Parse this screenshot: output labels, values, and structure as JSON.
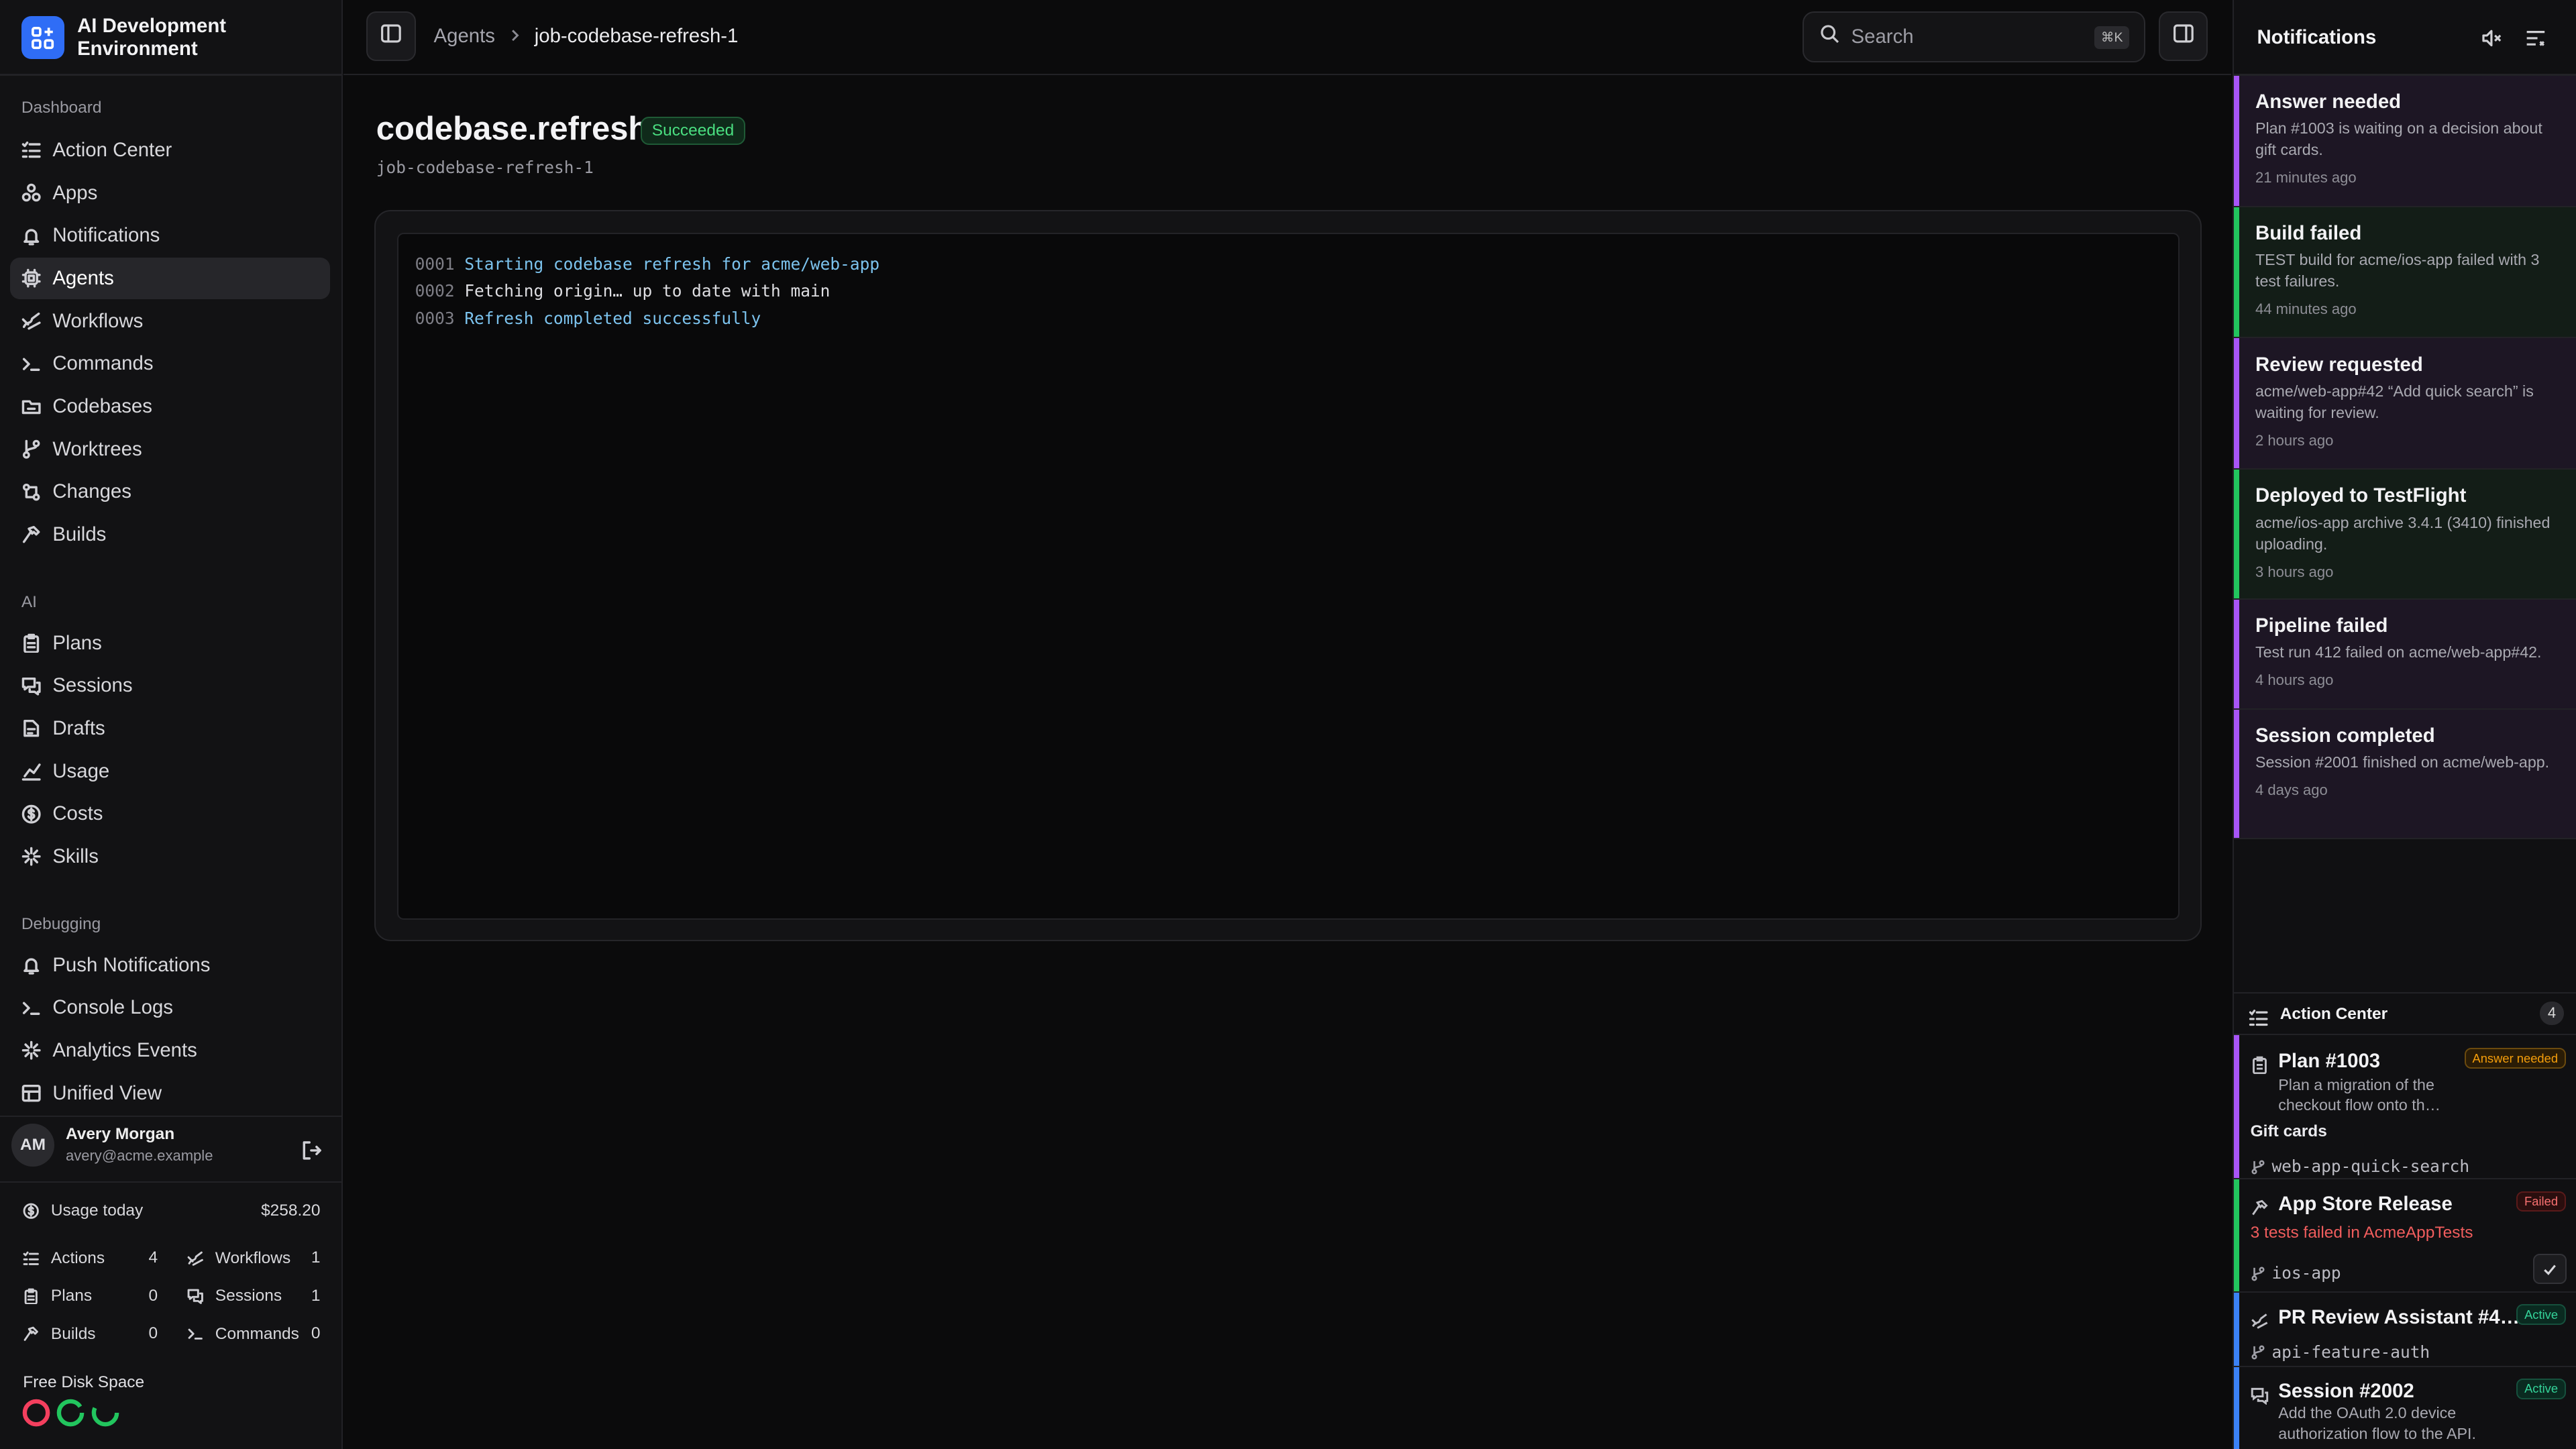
{
  "app": {
    "name": "AI Development Environment"
  },
  "sidebar": {
    "sections": [
      {
        "title": "Dashboard",
        "items": [
          {
            "label": "Action Center",
            "icon": "checklist-icon"
          },
          {
            "label": "Apps",
            "icon": "apps-icon"
          },
          {
            "label": "Notifications",
            "icon": "bell-icon"
          },
          {
            "label": "Agents",
            "icon": "agent-icon",
            "active": true
          },
          {
            "label": "Workflows",
            "icon": "workflow-icon"
          },
          {
            "label": "Commands",
            "icon": "terminal-icon"
          },
          {
            "label": "Codebases",
            "icon": "folder-icon"
          },
          {
            "label": "Worktrees",
            "icon": "branch-icon"
          },
          {
            "label": "Changes",
            "icon": "diff-icon"
          },
          {
            "label": "Builds",
            "icon": "hammer-icon"
          }
        ]
      },
      {
        "title": "AI",
        "items": [
          {
            "label": "Plans",
            "icon": "clipboard-icon"
          },
          {
            "label": "Sessions",
            "icon": "chat-icon"
          },
          {
            "label": "Drafts",
            "icon": "draft-icon"
          },
          {
            "label": "Usage",
            "icon": "chart-icon"
          },
          {
            "label": "Costs",
            "icon": "dollar-icon"
          },
          {
            "label": "Skills",
            "icon": "sparkle-icon"
          }
        ]
      },
      {
        "title": "Debugging",
        "items": [
          {
            "label": "Push Notifications",
            "icon": "bell-icon"
          },
          {
            "label": "Console Logs",
            "icon": "terminal-icon"
          },
          {
            "label": "Analytics Events",
            "icon": "sparkle-icon"
          },
          {
            "label": "Unified View",
            "icon": "grid-icon"
          }
        ]
      }
    ]
  },
  "user": {
    "initials": "AM",
    "name": "Avery Morgan",
    "email": "avery@acme.example"
  },
  "usage": {
    "label": "Usage today",
    "value": "$258.20",
    "stats": [
      {
        "label": "Actions",
        "value": "4"
      },
      {
        "label": "Workflows",
        "value": "1"
      },
      {
        "label": "Plans",
        "value": "0"
      },
      {
        "label": "Sessions",
        "value": "1"
      },
      {
        "label": "Builds",
        "value": "0"
      },
      {
        "label": "Commands",
        "value": "0"
      }
    ]
  },
  "disk": {
    "title": "Free Disk Space",
    "colors": [
      "#f43f5e",
      "#22c55e",
      "#22c55e"
    ]
  },
  "topbar": {
    "breadcrumbs": [
      "Agents",
      "job-codebase-refresh-1"
    ],
    "search_placeholder": "Search",
    "shortcut": "⌘K"
  },
  "job": {
    "title": "codebase.refresh",
    "status": "Succeeded",
    "id": "job-codebase-refresh-1",
    "log": [
      {
        "num": "0001",
        "text": "Starting codebase refresh for acme/web-app",
        "color": "blue"
      },
      {
        "num": "0002",
        "text": "Fetching origin… up to date with main",
        "color": "white"
      },
      {
        "num": "0003",
        "text": "Refresh completed successfully",
        "color": "blue"
      }
    ]
  },
  "notifications": {
    "title": "Notifications",
    "items": [
      {
        "title": "Answer needed",
        "body": "Plan #1003 is waiting on a decision about gift cards.",
        "time": "21 minutes ago",
        "accent": "#a855f7",
        "bg": "#1d1624"
      },
      {
        "title": "Build failed",
        "body": "TEST build for acme/ios-app failed with 3 test failures.",
        "time": "44 minutes ago",
        "accent": "#22c55e",
        "bg": "#131d17"
      },
      {
        "title": "Review requested",
        "body": "acme/web-app#42 “Add quick search” is waiting for review.",
        "time": "2 hours ago",
        "accent": "#a855f7",
        "bg": "#1d1624"
      },
      {
        "title": "Deployed to TestFlight",
        "body": "acme/ios-app archive 3.4.1 (3410) finished uploading.",
        "time": "3 hours ago",
        "accent": "#22c55e",
        "bg": "#131d17"
      },
      {
        "title": "Pipeline failed",
        "body": "Test run 412 failed on acme/web-app#42.",
        "time": "4 hours ago",
        "accent": "#a855f7",
        "bg": "#1d1624"
      },
      {
        "title": "Session completed",
        "body": "Session #2001 finished on acme/web-app.",
        "time": "4 days ago",
        "accent": "#a855f7",
        "bg": "#1d1624"
      }
    ]
  },
  "action_center": {
    "title": "Action Center",
    "count": "4",
    "items": [
      {
        "name": "Plan #1003",
        "badge": "Answer needed",
        "desc": "Plan a migration of the checkout flow onto th…",
        "sub": "Gift cards",
        "branch": "web-app-quick-search"
      },
      {
        "name": "App Store Release",
        "badge": "Failed",
        "error": "3 tests failed in AcmeAppTests",
        "branch": "ios-app"
      },
      {
        "name": "PR Review Assistant #4…",
        "badge": "Active",
        "branch": "api-feature-auth"
      },
      {
        "name": "Session #2002",
        "badge": "Active",
        "desc": "Add the OAuth 2.0 device authorization flow to the API."
      }
    ]
  }
}
